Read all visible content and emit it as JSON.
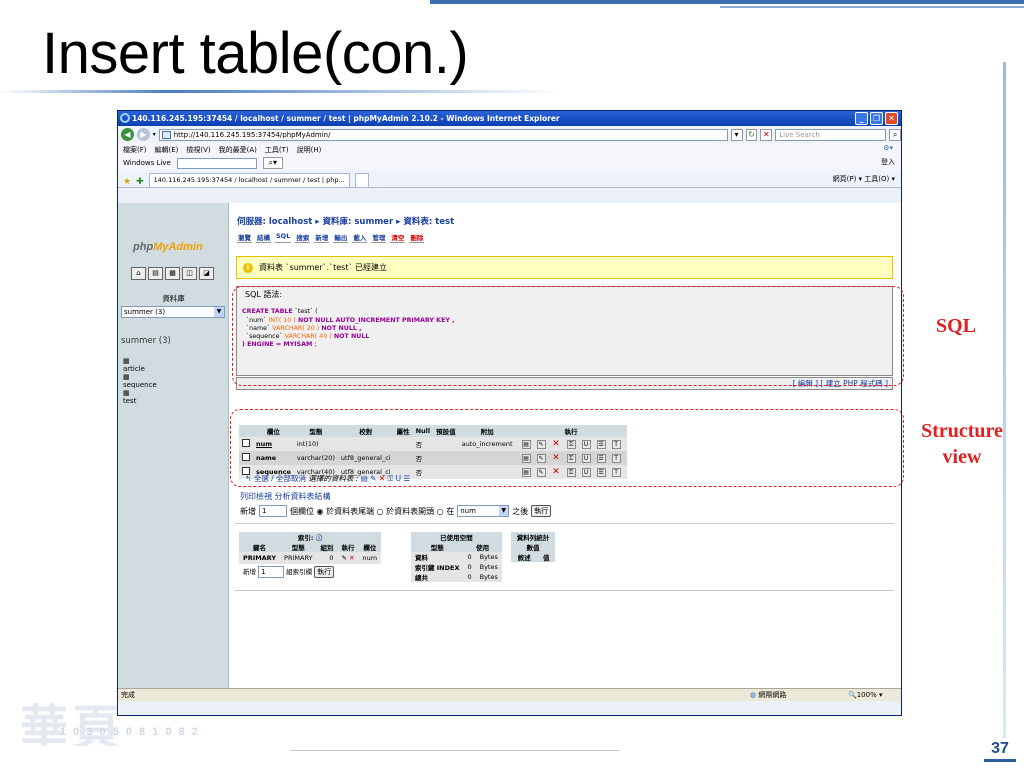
{
  "slide": {
    "title": "Insert table(con.)",
    "page_number": "37",
    "annotations": {
      "sql": "SQL",
      "structure_line1": "Structure",
      "structure_line2": "view"
    },
    "watermark": "華頁",
    "watermark_small": "1 0 3 0 5 0 8 1 0 8 2"
  },
  "browser": {
    "title": "140.116.245.195:37454 / localhost / summer / test | phpMyAdmin 2.10.2 - Windows Internet Explorer",
    "address": "http://140.116.245.195:37454/phpMyAdmin/",
    "search_placeholder": "Live Search",
    "menu": [
      "檔案(F)",
      "編輯(E)",
      "檢視(V)",
      "我的最愛(A)",
      "工具(T)",
      "說明(H)"
    ],
    "menu_right": "登入",
    "windows_live": "Windows Live",
    "tab_label": "140.116.245.195:37454 / localhost / summer / test | php...",
    "tab_tools": "網頁(P) ▾  工具(O) ▾",
    "status": "完成",
    "status_zone": "網際網路",
    "status_zoom": "100%"
  },
  "pma": {
    "logo_a": "php",
    "logo_b": "MyAdmin",
    "db_label": "資料庫",
    "db_select": "summer (3)",
    "db_name": "summer (3)",
    "tables": [
      "article",
      "sequence",
      "test"
    ],
    "breadcrumb": "伺服器: localhost ▸ 資料庫: summer ▸ 資料表: test",
    "tabs": [
      "瀏覽",
      "結構",
      "SQL",
      "搜索",
      "新增",
      "輸出",
      "載入",
      "管理",
      "清空",
      "刪除"
    ],
    "notice": "資料表 `summer`.`test` 已經建立",
    "sql_legend": "SQL 語法:",
    "sql_lines": [
      {
        "a": "CREATE TABLE",
        "b": " `test` ("
      },
      {
        "a": "",
        "b": "  `num` ",
        "c": "INT( 10 )",
        "d": " NOT NULL AUTO_INCREMENT PRIMARY KEY ,"
      },
      {
        "a": "",
        "b": "  `name` ",
        "c": "VARCHAR( 20 )",
        "d": " NOT NULL ,"
      },
      {
        "a": "",
        "b": "  `sequence` ",
        "c": "VARCHAR( 40 )",
        "d": " NOT NULL"
      },
      {
        "a": ") ENGINE = MYISAM",
        "b": " ;"
      }
    ],
    "sql_footer": "[ 編輯 ] [ 建立 PHP 程式碼 ]",
    "struct_headers": [
      "欄位",
      "型態",
      "校對",
      "屬性",
      "Null",
      "預設值",
      "附加",
      "執行"
    ],
    "struct_rows": [
      {
        "field": "num",
        "type": "int(10)",
        "collation": "",
        "null": "否",
        "extra": "auto_increment"
      },
      {
        "field": "name",
        "type": "varchar(20)",
        "collation": "utf8_general_ci",
        "null": "否",
        "extra": ""
      },
      {
        "field": "sequence",
        "type": "varchar(40)",
        "collation": "utf8_general_ci",
        "null": "否",
        "extra": ""
      }
    ],
    "check_all": "全選 / 全部取消",
    "with_selected": "選擇的資料表 :",
    "print_links": "列印檢視   分析資料表結構",
    "add_label": "新增",
    "add_count": "1",
    "add_text": "個欄位 ◉ 於資料表尾端 ○ 於資料表開頭 ○ 在",
    "add_after_field": "num",
    "add_after": "之後",
    "go": "執行",
    "index_title": "索引:",
    "index_headers": [
      "鍵名",
      "型態",
      "組別",
      "執行",
      "欄位"
    ],
    "index_row": {
      "key": "PRIMARY",
      "type": "PRIMARY",
      "card": "0",
      "field": "num"
    },
    "index_add": "新增",
    "index_add_count": "1",
    "index_add_text": "組索引欄",
    "space_title": "已使用空間",
    "space_headers": [
      "型態",
      "使用"
    ],
    "space_rows": [
      {
        "label": "資料",
        "v": "0",
        "u": "Bytes"
      },
      {
        "label": "索引鍵 INDEX",
        "v": "0",
        "u": "Bytes"
      },
      {
        "label": "總共",
        "v": "0",
        "u": "Bytes"
      }
    ],
    "rowstats_title": "資料列統計數值",
    "rowstats_headers": [
      "敘述",
      "值"
    ]
  }
}
